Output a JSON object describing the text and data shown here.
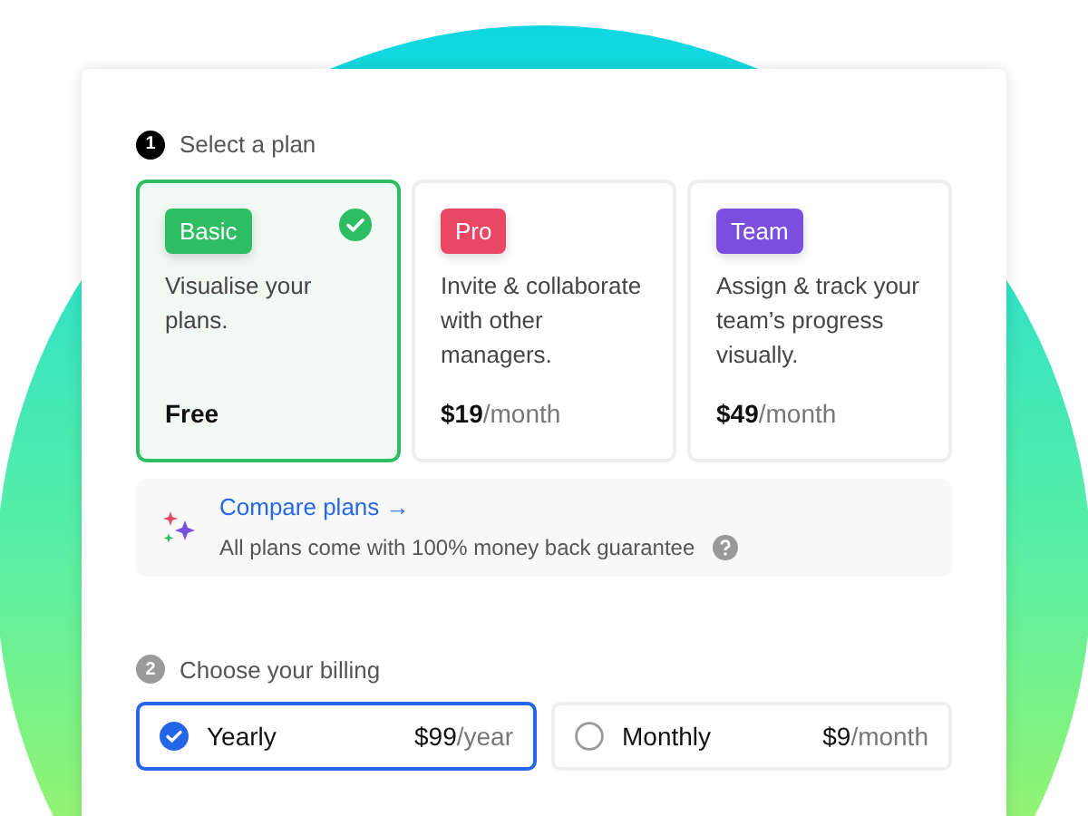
{
  "steps": [
    {
      "number": "1",
      "title": "Select a plan",
      "active": true
    },
    {
      "number": "2",
      "title": "Choose your billing",
      "active": false
    }
  ],
  "plans": [
    {
      "name": "Basic",
      "color": "#2dbd63",
      "description": "Visualise your plans.",
      "amount": "Free",
      "selected": true
    },
    {
      "name": "Pro",
      "color": "#ea4764",
      "description": "Invite & collaborate with other managers.",
      "amount": "$19",
      "unit": "/month",
      "selected": false
    },
    {
      "name": "Team",
      "color": "#7a4fe0",
      "description": "Assign & track your team’s progress visually.",
      "amount": "$49",
      "unit": "/month",
      "selected": false
    }
  ],
  "compare": {
    "link": "Compare plans →",
    "note": "All plans come with 100% money back guarantee"
  },
  "billing": [
    {
      "label": "Yearly",
      "amount": "$99",
      "unit": "/year",
      "selected": true
    },
    {
      "label": "Monthly",
      "amount": "$9",
      "unit": "/month",
      "selected": false
    }
  ]
}
